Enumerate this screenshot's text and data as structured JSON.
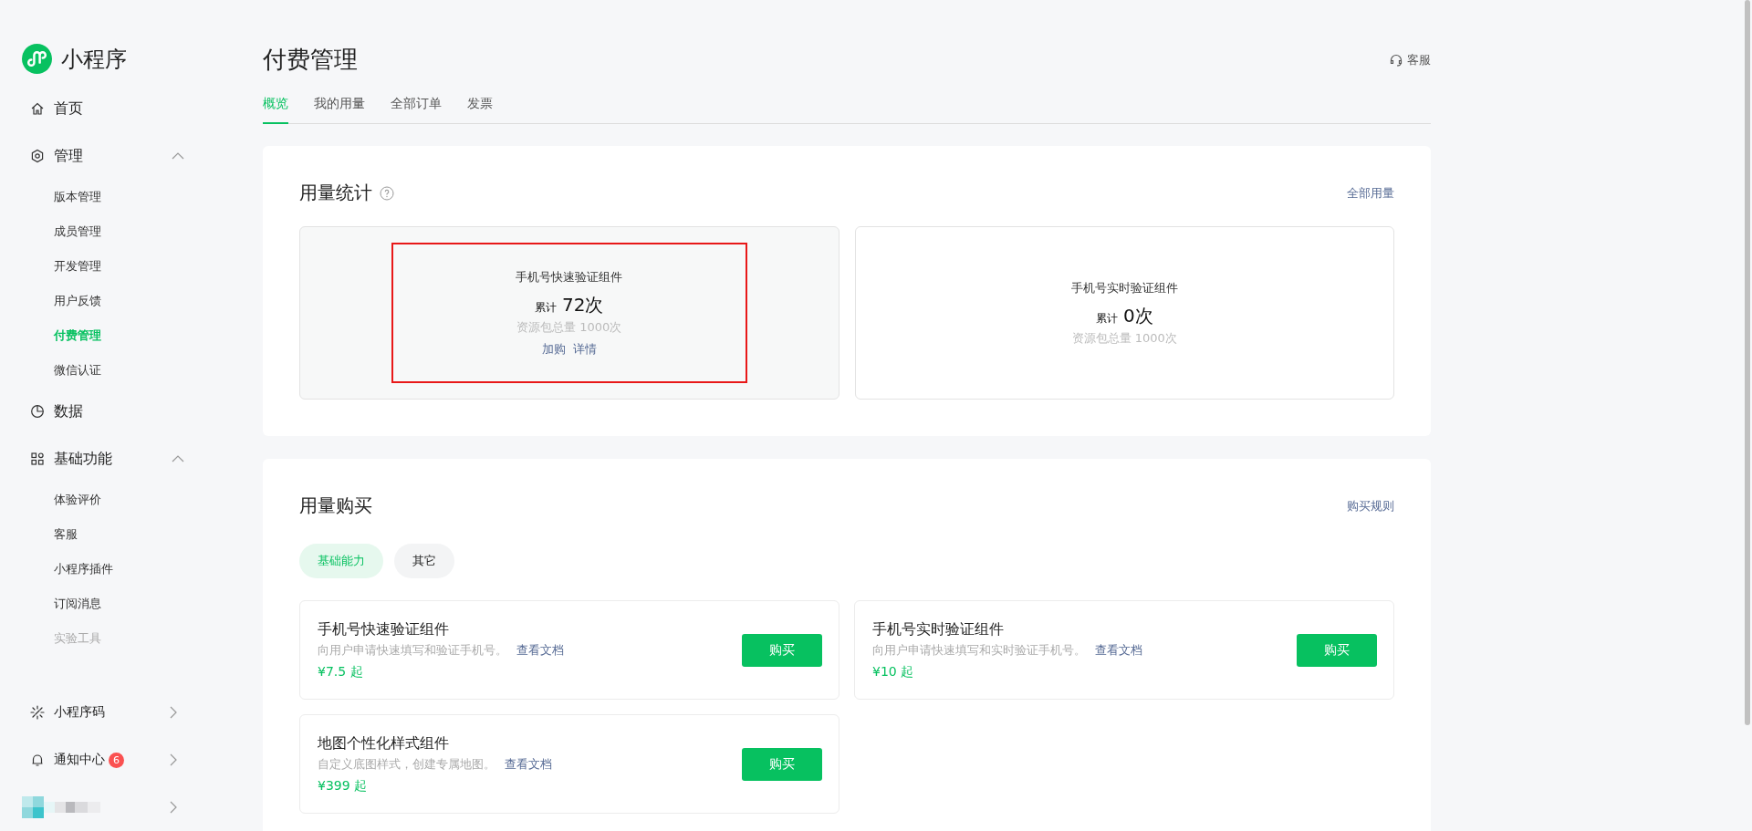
{
  "sidebar": {
    "brand": "小程序",
    "items": [
      {
        "kind": "link",
        "label": "首页",
        "selected": false
      },
      {
        "kind": "group",
        "label": "管理",
        "expanded": true,
        "children": [
          {
            "label": "版本管理",
            "selected": false,
            "disabled": false
          },
          {
            "label": "成员管理",
            "selected": false,
            "disabled": false
          },
          {
            "label": "开发管理",
            "selected": false,
            "disabled": false
          },
          {
            "label": "用户反馈",
            "selected": false,
            "disabled": false
          },
          {
            "label": "付费管理",
            "selected": true,
            "disabled": false
          },
          {
            "label": "微信认证",
            "selected": false,
            "disabled": false
          }
        ]
      },
      {
        "kind": "link",
        "label": "数据",
        "selected": false
      },
      {
        "kind": "group",
        "label": "基础功能",
        "expanded": true,
        "children": [
          {
            "label": "体验评价",
            "selected": false,
            "disabled": false
          },
          {
            "label": "客服",
            "selected": false,
            "disabled": false
          },
          {
            "label": "小程序插件",
            "selected": false,
            "disabled": false
          },
          {
            "label": "订阅消息",
            "selected": false,
            "disabled": false
          },
          {
            "label": "实验工具",
            "selected": false,
            "disabled": true
          }
        ]
      }
    ],
    "footer": [
      {
        "kind": "qrcode",
        "label": "小程序码"
      },
      {
        "kind": "bell",
        "label": "通知中心",
        "badge": "6"
      },
      {
        "kind": "account"
      }
    ]
  },
  "page": {
    "title": "付费管理",
    "service": "客服",
    "tabs": [
      {
        "label": "概览",
        "selected": true
      },
      {
        "label": "我的用量",
        "selected": false
      },
      {
        "label": "全部订单",
        "selected": false
      },
      {
        "label": "发票",
        "selected": false
      }
    ]
  },
  "usage": {
    "title": "用量统计",
    "link": "全部用量",
    "cards": [
      {
        "name": "手机号快速验证组件",
        "prefix": "累计",
        "count": "72次",
        "total": "资源包总量 1000次",
        "actions": [
          "加购",
          "详情"
        ],
        "highlighted": true
      },
      {
        "name": "手机号实时验证组件",
        "prefix": "累计",
        "count": "0次",
        "total": "资源包总量 1000次",
        "highlighted": false
      }
    ]
  },
  "purchase": {
    "title": "用量购买",
    "link": "购买规则",
    "filters": [
      {
        "label": "基础能力",
        "selected": true
      },
      {
        "label": "其它",
        "selected": false
      }
    ],
    "products": [
      {
        "name": "手机号快速验证组件",
        "desc": "向用户申请快速填写和验证手机号。",
        "doc": "查看文档",
        "price": "¥7.5 起",
        "button": "购买"
      },
      {
        "name": "手机号实时验证组件",
        "desc": "向用户申请快速填写和实时验证手机号。",
        "doc": "查看文档",
        "price": "¥10 起",
        "button": "购买"
      },
      {
        "name": "地图个性化样式组件",
        "desc": "自定义底图样式，创建专属地图。",
        "doc": "查看文档",
        "price": "¥399 起",
        "button": "购买"
      }
    ]
  }
}
